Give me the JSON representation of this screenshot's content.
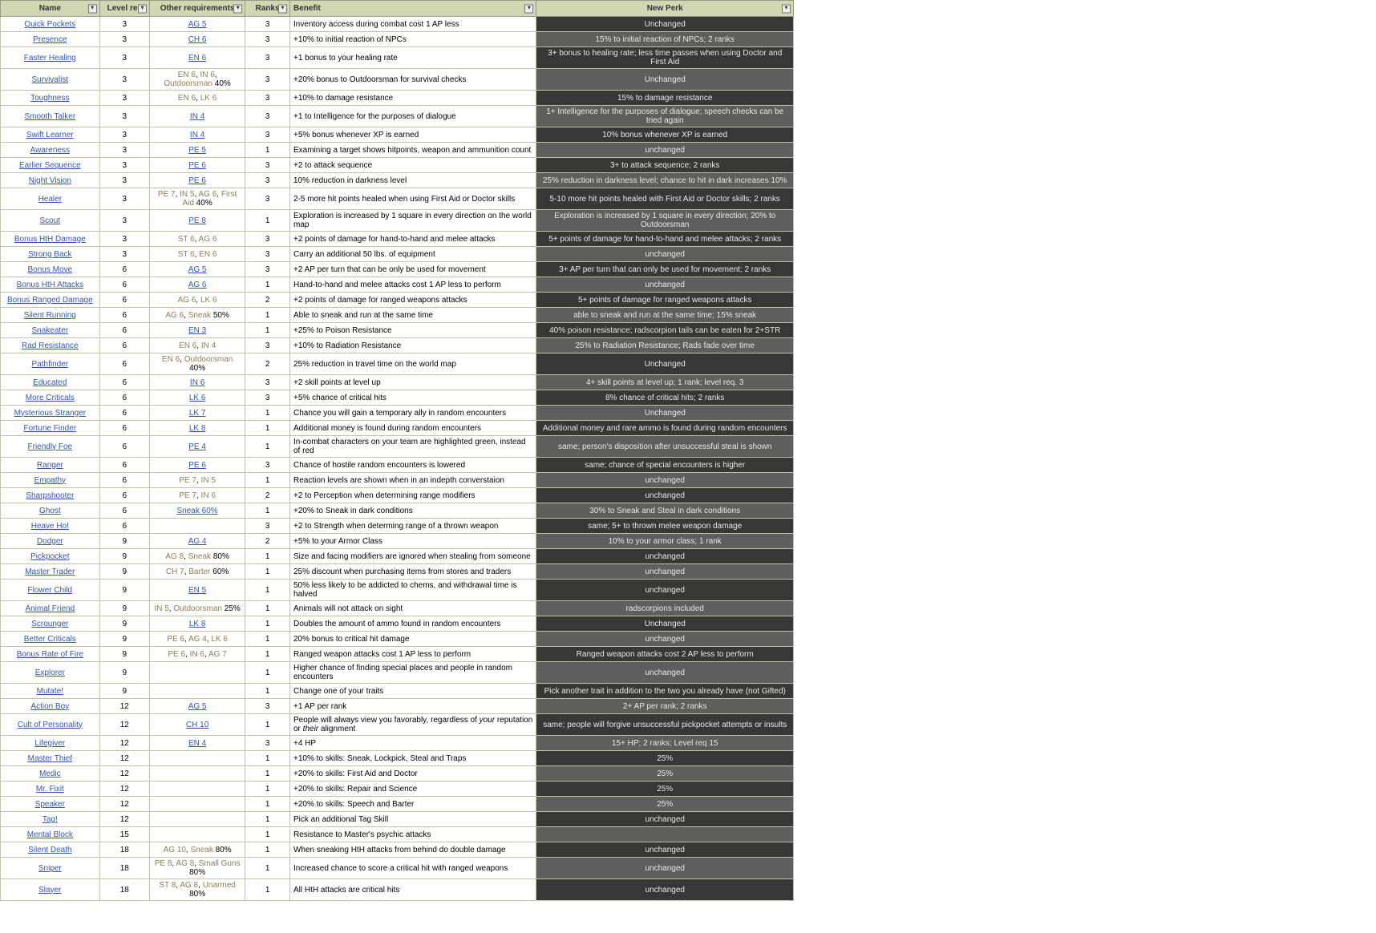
{
  "headers": {
    "name": "Name",
    "level": "Level rec",
    "req": "Other requirements",
    "ranks": "Ranks",
    "benefit": "Benefit",
    "perk": "New Perk"
  },
  "rows": [
    {
      "name": "Quick Pockets",
      "level": "3",
      "req": [
        {
          "t": "AG 5",
          "l": 1
        }
      ],
      "ranks": "3",
      "benefit": "Inventory access during combat cost 1 AP less",
      "perk": "Unchanged",
      "shade": 1
    },
    {
      "name": "Presence",
      "level": "3",
      "req": [
        {
          "t": "CH 6",
          "l": 1
        }
      ],
      "ranks": "3",
      "benefit": "+10% to initial reaction of NPCs",
      "perk": "15% to initial reaction of NPCs; 2 ranks",
      "shade": 2
    },
    {
      "name": "Faster Healing",
      "level": "3",
      "req": [
        {
          "t": "EN 6",
          "l": 1
        }
      ],
      "ranks": "3",
      "benefit": "+1 bonus to your healing rate",
      "perk": "3+ bonus to healing rate; less time passes when using Doctor and First Aid",
      "shade": 1
    },
    {
      "name": "Survivalist",
      "level": "3",
      "req": [
        {
          "t": "EN 6",
          "p": 1
        },
        {
          "t": ", "
        },
        {
          "t": "IN 6",
          "p": 1
        },
        {
          "t": ", "
        },
        {
          "t": "Outdoorsman",
          "p": 1
        },
        {
          "t": " 40%"
        }
      ],
      "ranks": "3",
      "benefit": "+20% bonus to Outdoorsman for survival checks",
      "perk": "Unchanged",
      "shade": 2
    },
    {
      "name": "Toughness",
      "level": "3",
      "req": [
        {
          "t": "EN 6",
          "p": 1
        },
        {
          "t": ", "
        },
        {
          "t": "LK 6",
          "p": 1
        }
      ],
      "ranks": "3",
      "benefit": "+10% to damage resistance",
      "perk": "15% to damage resistance",
      "shade": 1
    },
    {
      "name": "Smooth Talker",
      "level": "3",
      "req": [
        {
          "t": "IN 4",
          "l": 1
        }
      ],
      "ranks": "3",
      "benefit": "+1 to Intelligence for the purposes of dialogue",
      "perk": "1+ Intelligence for the purposes of dialogue; speech checks can be tried again",
      "shade": 2
    },
    {
      "name": "Swift Learner",
      "level": "3",
      "req": [
        {
          "t": "IN 4",
          "l": 1
        }
      ],
      "ranks": "3",
      "benefit": "+5% bonus whenever XP is earned",
      "perk": "10% bonus whenever XP is earned",
      "shade": 1
    },
    {
      "name": "Awareness",
      "level": "3",
      "req": [
        {
          "t": "PE 5",
          "l": 1
        }
      ],
      "ranks": "1",
      "benefit": "Examining a target shows hitpoints, weapon and ammunition count",
      "perk": "unchanged",
      "shade": 2
    },
    {
      "name": "Earlier Sequence",
      "level": "3",
      "req": [
        {
          "t": "PE 6",
          "l": 1
        }
      ],
      "ranks": "3",
      "benefit": "+2 to attack sequence",
      "perk": "3+ to attack sequence; 2 ranks",
      "shade": 1
    },
    {
      "name": "Night Vision",
      "level": "3",
      "req": [
        {
          "t": "PE 6",
          "l": 1
        }
      ],
      "ranks": "3",
      "benefit": "10% reduction in darkness level",
      "perk": "25% reduction in darkness level; chance to hit in dark increases 10%",
      "shade": 2
    },
    {
      "name": "Healer",
      "level": "3",
      "req": [
        {
          "t": "PE 7",
          "p": 1
        },
        {
          "t": ", "
        },
        {
          "t": "IN 5",
          "p": 1
        },
        {
          "t": ", "
        },
        {
          "t": "AG 6",
          "p": 1
        },
        {
          "t": ", "
        },
        {
          "t": "First Aid",
          "p": 1
        },
        {
          "t": " 40%"
        }
      ],
      "ranks": "3",
      "benefit": "2-5 more hit points healed when using First Aid or Doctor skills",
      "perk": "5-10 more hit points healed with First Aid or Doctor skills; 2 ranks",
      "shade": 1
    },
    {
      "name": "Scout",
      "level": "3",
      "req": [
        {
          "t": "PE 8",
          "l": 1
        }
      ],
      "ranks": "1",
      "benefit": "Exploration is increased by 1 square in every direction on the world map",
      "perk": "Exploration is increased by 1 square in every direction; 20% to Outdoorsman",
      "shade": 2
    },
    {
      "name": "Bonus HtH Damage",
      "level": "3",
      "req": [
        {
          "t": "ST 6",
          "p": 1
        },
        {
          "t": ", "
        },
        {
          "t": "AG 6",
          "p": 1
        }
      ],
      "ranks": "3",
      "benefit": "+2 points of damage for hand-to-hand and melee attacks",
      "perk": "5+ points of damage for hand-to-hand and melee attacks; 2 ranks",
      "shade": 1
    },
    {
      "name": "Strong Back",
      "level": "3",
      "req": [
        {
          "t": "ST 6",
          "p": 1
        },
        {
          "t": ", "
        },
        {
          "t": "EN 6",
          "p": 1
        }
      ],
      "ranks": "3",
      "benefit": "Carry an additional 50 lbs. of equipment",
      "perk": "unchanged",
      "shade": 2
    },
    {
      "name": "Bonus Move",
      "level": "6",
      "req": [
        {
          "t": "AG 5",
          "l": 1
        }
      ],
      "ranks": "3",
      "benefit": "+2 AP per turn that can be only be used for movement",
      "perk": "3+ AP per turn that can only be used for movement; 2 ranks",
      "shade": 1
    },
    {
      "name": "Bonus HtH Attacks",
      "level": "6",
      "req": [
        {
          "t": "AG 6",
          "l": 1
        }
      ],
      "ranks": "1",
      "benefit": "Hand-to-hand and melee attacks cost 1 AP less to perform",
      "perk": "unchanged",
      "shade": 2
    },
    {
      "name": "Bonus Ranged Damage",
      "level": "6",
      "req": [
        {
          "t": "AG 6",
          "p": 1
        },
        {
          "t": ", "
        },
        {
          "t": "LK 6",
          "p": 1
        }
      ],
      "ranks": "2",
      "benefit": "+2 points of damage for ranged weapons attacks",
      "perk": "5+ points of damage for ranged weapons attacks",
      "shade": 1
    },
    {
      "name": "Silent Running",
      "level": "6",
      "req": [
        {
          "t": "AG 6",
          "p": 1
        },
        {
          "t": ", "
        },
        {
          "t": "Sneak",
          "p": 1
        },
        {
          "t": " 50%"
        }
      ],
      "ranks": "1",
      "benefit": "Able to sneak and run at the same time",
      "perk": "able to sneak and run at the same time; 15% sneak",
      "shade": 2
    },
    {
      "name": "Snakeater",
      "level": "6",
      "req": [
        {
          "t": "EN 3",
          "l": 1
        }
      ],
      "ranks": "1",
      "benefit": "+25% to Poison Resistance",
      "perk": "40% poison resistance; radscorpion tails can be eaten for 2+STR",
      "shade": 1
    },
    {
      "name": "Rad Resistance",
      "level": "6",
      "req": [
        {
          "t": "EN 6",
          "p": 1
        },
        {
          "t": ", "
        },
        {
          "t": "IN 4",
          "p": 1
        }
      ],
      "ranks": "3",
      "benefit": "+10% to Radiation Resistance",
      "perk": "25% to Radiation Resistance; Rads fade over time",
      "shade": 2
    },
    {
      "name": "Pathfinder",
      "level": "6",
      "req": [
        {
          "t": "EN 6",
          "p": 1
        },
        {
          "t": ", "
        },
        {
          "t": "Outdoorsman",
          "p": 1
        },
        {
          "t": " 40%"
        }
      ],
      "ranks": "2",
      "benefit": "25% reduction in travel time on the world map",
      "perk": "Unchanged",
      "shade": 1
    },
    {
      "name": "Educated",
      "level": "6",
      "req": [
        {
          "t": "IN 6",
          "l": 1
        }
      ],
      "ranks": "3",
      "benefit": "+2 skill points at level up",
      "perk": "4+ skill points at level up; 1 rank; level req. 3",
      "shade": 2
    },
    {
      "name": "More Criticals",
      "level": "6",
      "req": [
        {
          "t": "LK 6",
          "l": 1
        }
      ],
      "ranks": "3",
      "benefit": "+5% chance of critical hits",
      "perk": "8% chance of critical hits; 2 ranks",
      "shade": 1
    },
    {
      "name": "Mysterious Stranger",
      "level": "6",
      "req": [
        {
          "t": "LK 7",
          "l": 1
        }
      ],
      "ranks": "1",
      "benefit": "Chance you will gain a temporary ally in random encounters",
      "perk": "Unchanged",
      "shade": 2
    },
    {
      "name": "Fortune Finder",
      "level": "6",
      "req": [
        {
          "t": "LK 8",
          "l": 1
        }
      ],
      "ranks": "1",
      "benefit": "Additional money is found during random encounters",
      "perk": "Additional money and rare ammo is found during random encounters",
      "shade": 1
    },
    {
      "name": "Friendly Foe",
      "level": "6",
      "req": [
        {
          "t": "PE 4",
          "l": 1
        }
      ],
      "ranks": "1",
      "benefit": "In-combat characters on your team are highlighted green, instead of red",
      "perk": "same; person's disposition after unsuccessful steal is shown",
      "shade": 2
    },
    {
      "name": "Ranger",
      "level": "6",
      "req": [
        {
          "t": "PE 6",
          "l": 1
        }
      ],
      "ranks": "3",
      "benefit": "Chance of hostile random encounters is lowered",
      "perk": "same; chance of special encounters is higher",
      "shade": 1
    },
    {
      "name": "Empathy",
      "level": "6",
      "req": [
        {
          "t": "PE 7",
          "p": 1
        },
        {
          "t": ", "
        },
        {
          "t": "IN 5",
          "p": 1
        }
      ],
      "ranks": "1",
      "benefit": "Reaction levels are shown when in an indepth converstaion",
      "perk": "unchanged",
      "shade": 2
    },
    {
      "name": "Sharpshooter",
      "level": "6",
      "req": [
        {
          "t": "PE 7",
          "p": 1
        },
        {
          "t": ", "
        },
        {
          "t": "IN 6",
          "p": 1
        }
      ],
      "ranks": "2",
      "benefit": "+2 to Perception when determining range modifiers",
      "perk": "unchanged",
      "shade": 1
    },
    {
      "name": "Ghost",
      "level": "6",
      "req": [
        {
          "t": "Sneak 60%",
          "l": 1
        }
      ],
      "ranks": "1",
      "benefit": "+20% to Sneak in dark conditions",
      "perk": "30% to Sneak and Steal in dark conditions",
      "shade": 2
    },
    {
      "name": "Heave Ho!",
      "level": "6",
      "req": [],
      "ranks": "3",
      "benefit": "+2 to Strength when determing range of a thrown weapon",
      "perk": "same; 5+ to thrown melee weapon damage",
      "shade": 1
    },
    {
      "name": "Dodger",
      "level": "9",
      "req": [
        {
          "t": "AG 4",
          "l": 1
        }
      ],
      "ranks": "2",
      "benefit": "+5% to your Armor Class",
      "perk": "10% to your armor class; 1 rank",
      "shade": 2
    },
    {
      "name": "Pickpocket",
      "level": "9",
      "req": [
        {
          "t": "AG 8",
          "p": 1
        },
        {
          "t": ", "
        },
        {
          "t": "Sneak",
          "p": 1
        },
        {
          "t": " 80%"
        }
      ],
      "ranks": "1",
      "benefit": "Size and facing modifiers are ignored when stealing from someone",
      "perk": "unchanged",
      "shade": 1
    },
    {
      "name": "Master Trader",
      "level": "9",
      "req": [
        {
          "t": "CH 7",
          "p": 1
        },
        {
          "t": ", "
        },
        {
          "t": "Barter",
          "p": 1
        },
        {
          "t": " 60%"
        }
      ],
      "ranks": "1",
      "benefit": "25% discount when purchasing items from stores and traders",
      "perk": "unchanged",
      "shade": 2
    },
    {
      "name": "Flower Child",
      "level": "9",
      "req": [
        {
          "t": "EN 5",
          "l": 1
        }
      ],
      "ranks": "1",
      "benefit": "50% less likely to be addicted to chems, and withdrawal time is halved",
      "perk": "unchanged",
      "shade": 1
    },
    {
      "name": "Animal Friend",
      "level": "9",
      "req": [
        {
          "t": "IN 5",
          "p": 1
        },
        {
          "t": ", "
        },
        {
          "t": "Outdoorsman",
          "p": 1
        },
        {
          "t": " 25%"
        }
      ],
      "ranks": "1",
      "benefit": "Animals will not attack on sight",
      "perk": "radscorpions included",
      "shade": 2
    },
    {
      "name": "Scrounger",
      "level": "9",
      "req": [
        {
          "t": "LK 8",
          "l": 1
        }
      ],
      "ranks": "1",
      "benefit": "Doubles the amount of ammo found in random encounters",
      "perk": "Unchanged",
      "shade": 1
    },
    {
      "name": "Better Criticals",
      "level": "9",
      "req": [
        {
          "t": "PE 6",
          "p": 1
        },
        {
          "t": ", "
        },
        {
          "t": "AG 4",
          "p": 1
        },
        {
          "t": ", "
        },
        {
          "t": "LK 6",
          "p": 1
        }
      ],
      "ranks": "1",
      "benefit": "20% bonus to critical hit damage",
      "perk": "unchanged",
      "shade": 2
    },
    {
      "name": "Bonus Rate of Fire",
      "level": "9",
      "req": [
        {
          "t": "PE 6",
          "p": 1
        },
        {
          "t": ", "
        },
        {
          "t": "IN 6",
          "p": 1
        },
        {
          "t": ", "
        },
        {
          "t": "AG 7",
          "p": 1
        }
      ],
      "ranks": "1",
      "benefit": "Ranged weapon attacks cost 1 AP less to perform",
      "perk": "Ranged weapon attacks cost 2 AP less to perform",
      "shade": 1
    },
    {
      "name": "Explorer",
      "level": "9",
      "req": [],
      "ranks": "1",
      "benefit": "Higher chance of finding special places and people in random encounters",
      "perk": "unchanged",
      "shade": 2
    },
    {
      "name": "Mutate!",
      "level": "9",
      "req": [],
      "ranks": "1",
      "benefit": "Change one of your traits",
      "perk": "Pick another trait in addition to the two you already have (not Gifted)",
      "shade": 1
    },
    {
      "name": "Action Boy",
      "level": "12",
      "req": [
        {
          "t": "AG 5",
          "l": 1
        }
      ],
      "ranks": "3",
      "benefit": "+1 AP per rank",
      "perk": "2+ AP per rank; 2 ranks",
      "shade": 2
    },
    {
      "name": "Cult of Personality",
      "level": "12",
      "req": [
        {
          "t": "CH 10",
          "l": 1
        }
      ],
      "ranks": "1",
      "benefit_html": "People will always view you favorably, regardless of <i>your</i> reputation or <i>their</i> alignment",
      "perk": "same; people will forgive unsuccessful pickpocket attempts or insults",
      "shade": 1
    },
    {
      "name": "Lifegiver",
      "level": "12",
      "req": [
        {
          "t": "EN 4",
          "l": 1
        }
      ],
      "ranks": "3",
      "benefit": "+4 HP",
      "perk": "15+ HP; 2 ranks; Level req 15",
      "shade": 2
    },
    {
      "name": "Master Thief",
      "level": "12",
      "req": [],
      "ranks": "1",
      "benefit": "+10% to skills: Sneak, Lockpick, Steal and Traps",
      "perk": "25%",
      "shade": 1
    },
    {
      "name": "Medic",
      "level": "12",
      "req": [],
      "ranks": "1",
      "benefit": "+20% to skills: First Aid and Doctor",
      "perk": "25%",
      "shade": 2
    },
    {
      "name": "Mr. Fixit",
      "level": "12",
      "req": [],
      "ranks": "1",
      "benefit": "+20% to skills: Repair and Science",
      "perk": "25%",
      "shade": 1
    },
    {
      "name": "Speaker",
      "level": "12",
      "req": [],
      "ranks": "1",
      "benefit": "+20% to skills: Speech and Barter",
      "perk": "25%",
      "shade": 2
    },
    {
      "name": "Tag!",
      "level": "12",
      "req": [],
      "ranks": "1",
      "benefit": "Pick an additional Tag Skill",
      "perk": "unchanged",
      "shade": 1
    },
    {
      "name": "Mental Block",
      "level": "15",
      "req": [],
      "ranks": "1",
      "benefit": "Resistance to Master's psychic attacks",
      "perk": "",
      "shade": 2
    },
    {
      "name": "Silent Death",
      "level": "18",
      "req": [
        {
          "t": "AG 10",
          "p": 1
        },
        {
          "t": ", "
        },
        {
          "t": "Sneak",
          "p": 1
        },
        {
          "t": " 80%"
        }
      ],
      "ranks": "1",
      "benefit": "When sneaking HtH attacks from behind do double damage",
      "perk": "unchanged",
      "shade": 1
    },
    {
      "name": "Sniper",
      "level": "18",
      "req": [
        {
          "t": "PE 8",
          "p": 1
        },
        {
          "t": ", "
        },
        {
          "t": "AG 8",
          "p": 1
        },
        {
          "t": ", "
        },
        {
          "t": "Small Guns",
          "p": 1
        },
        {
          "t": " 80%"
        }
      ],
      "ranks": "1",
      "benefit": "Increased chance to score a critical hit with ranged weapons",
      "perk": "unchanged",
      "shade": 2
    },
    {
      "name": "Slayer",
      "level": "18",
      "req": [
        {
          "t": "ST 8",
          "p": 1
        },
        {
          "t": ", "
        },
        {
          "t": "AG 8",
          "p": 1
        },
        {
          "t": ", "
        },
        {
          "t": "Unarmed",
          "p": 1
        },
        {
          "t": " 80%"
        }
      ],
      "ranks": "1",
      "benefit": "All HtH attacks are critical hits",
      "perk": "unchanged",
      "shade": 1
    }
  ]
}
